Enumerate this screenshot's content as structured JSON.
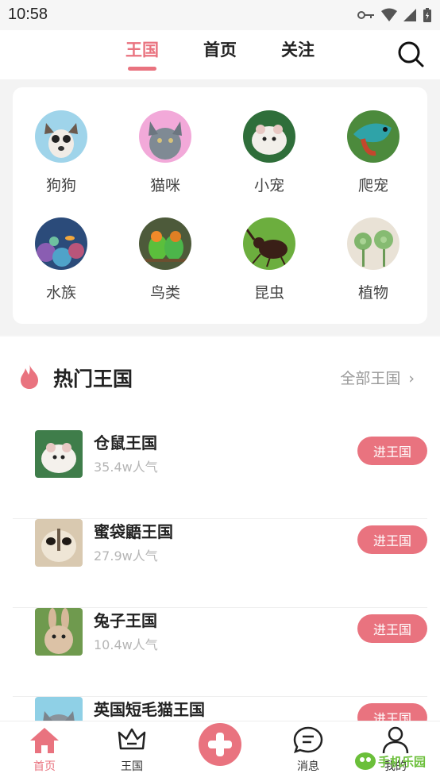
{
  "status_bar": {
    "time": "10:58"
  },
  "top_nav": {
    "tabs": [
      {
        "label": "王国",
        "active": true
      },
      {
        "label": "首页",
        "active": false
      },
      {
        "label": "关注",
        "active": false
      }
    ],
    "search_icon": "search-icon"
  },
  "categories": [
    {
      "label": "狗狗",
      "icon": "dog-avatar"
    },
    {
      "label": "猫咪",
      "icon": "cat-avatar"
    },
    {
      "label": "小宠",
      "icon": "small-pet-avatar"
    },
    {
      "label": "爬宠",
      "icon": "reptile-avatar"
    },
    {
      "label": "水族",
      "icon": "aquarium-avatar"
    },
    {
      "label": "鸟类",
      "icon": "bird-avatar"
    },
    {
      "label": "昆虫",
      "icon": "insect-avatar"
    },
    {
      "label": "植物",
      "icon": "plant-avatar"
    }
  ],
  "hot": {
    "title": "热门王国",
    "all_link": "全部王国",
    "items": [
      {
        "name": "仓鼠王国",
        "popularity": "35.4w人气",
        "button": "进王国"
      },
      {
        "name": "蜜袋鼯王国",
        "popularity": "27.9w人气",
        "button": "进王国"
      },
      {
        "name": "兔子王国",
        "popularity": "10.4w人气",
        "button": "进王国"
      },
      {
        "name": "英国短毛猫王国",
        "popularity": "",
        "button": "进王国"
      }
    ]
  },
  "bottom_nav": [
    {
      "label": "首页",
      "icon": "home-icon",
      "active": true
    },
    {
      "label": "王国",
      "icon": "crown-icon",
      "active": false
    },
    {
      "label": "",
      "icon": "plus-icon",
      "active": false
    },
    {
      "label": "消息",
      "icon": "message-icon",
      "active": false
    },
    {
      "label": "我的",
      "icon": "user-icon",
      "active": false
    }
  ],
  "watermark": "手机乐园",
  "colors": {
    "accent": "#e9737f",
    "text": "#222222",
    "muted": "#b5b5b5"
  }
}
